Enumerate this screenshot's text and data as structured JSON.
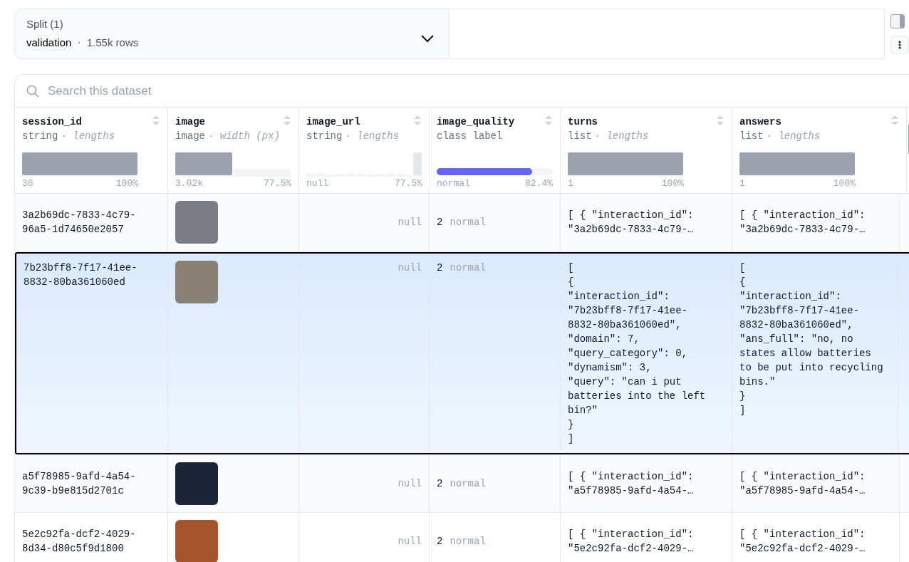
{
  "split": {
    "label": "Split (1)",
    "value": "validation",
    "separator": "·",
    "count": "1.55k rows"
  },
  "search": {
    "placeholder": "Search this dataset"
  },
  "columns": [
    {
      "name": "session_id",
      "dtype": "string",
      "stat": "· lengths",
      "kind": "full",
      "min": "36",
      "max": "100%"
    },
    {
      "name": "image",
      "dtype": "image",
      "stat": "· width (px)",
      "kind": "split",
      "min": "3.02k",
      "max": "77.5%"
    },
    {
      "name": "image_url",
      "dtype": "string",
      "stat": "· lengths",
      "kind": "null",
      "min": "null",
      "max": "77.5%"
    },
    {
      "name": "image_quality",
      "dtype": "class label",
      "kind": "class",
      "level": 0.824,
      "min": "normal",
      "max": "82.4%"
    },
    {
      "name": "turns",
      "dtype": "list",
      "stat": "· lengths",
      "kind": "full",
      "min": "1",
      "max": "100%"
    },
    {
      "name": "answers",
      "dtype": "list",
      "stat": "· lengths",
      "kind": "full",
      "min": "1",
      "max": "100%"
    }
  ],
  "rows": [
    {
      "selected": false,
      "session_id": "3a2b69dc-7833-4c79-96a5-1d74650e2057",
      "image_url": "null",
      "class_id": "2",
      "class_name": "normal",
      "turns": "[ { \"interaction_id\": \"3a2b69dc-7833-4c79-…",
      "answers": "[ { \"interaction_id\": \"3a2b69dc-7833-4c79-…"
    },
    {
      "selected": true,
      "session_id": "7b23bff8-7f17-41ee-8832-80ba361060ed",
      "image_url": "null",
      "class_id": "2",
      "class_name": "normal",
      "turns": "[\n{\n\"interaction_id\":\n\"7b23bff8-7f17-41ee-\n8832-80ba361060ed\",\n\"domain\": 7,\n\"query_category\": 0,\n\"dynamism\": 3,\n\"query\": \"can i put\nbatteries into the left\nbin?\"\n}\n]",
      "answers": "[\n{\n\"interaction_id\":\n\"7b23bff8-7f17-41ee-\n8832-80ba361060ed\",\n\"ans_full\": \"no, no\nstates allow batteries\nto be put into recycling\nbins.\"\n}\n]"
    },
    {
      "selected": false,
      "session_id": "a5f78985-9afd-4a54-9c39-b9e815d2701c",
      "image_url": "null",
      "class_id": "2",
      "class_name": "normal",
      "turns": "[ { \"interaction_id\": \"a5f78985-9afd-4a54-…",
      "answers": "[ { \"interaction_id\": \"a5f78985-9afd-4a54-…"
    },
    {
      "selected": false,
      "session_id": "5e2c92fa-dcf2-4029-8d34-d80c5f9d1800",
      "image_url": "null",
      "class_id": "2",
      "class_name": "normal",
      "turns": "[ { \"interaction_id\": \"5e2c92fa-dcf2-4029-…",
      "answers": "[ { \"interaction_id\": \"5e2c92fa-dcf2-4029-…"
    }
  ]
}
